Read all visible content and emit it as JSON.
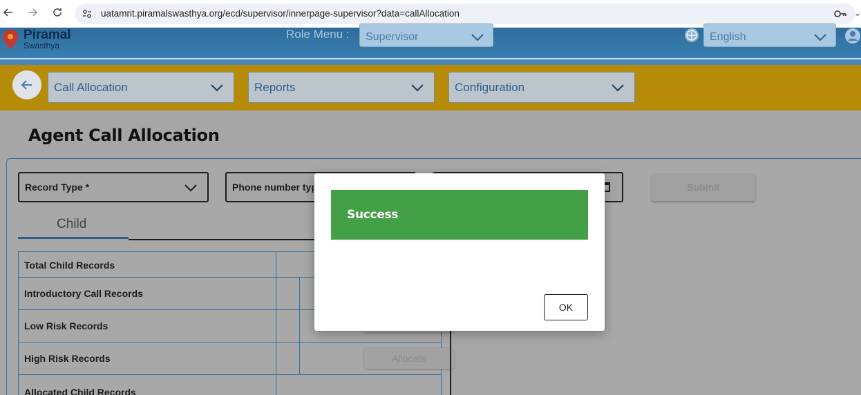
{
  "browser": {
    "url": "uatamrit.piramalswasthya.org/ecd/supervisor/innerpage-supervisor?data=callAllocation"
  },
  "header": {
    "logo_name": "Piramal",
    "logo_sub": "Swasthya",
    "role_label": "Role Menu :",
    "role_value": "Supervisor",
    "language_value": "English"
  },
  "menu": {
    "items": [
      {
        "label": "Call Allocation"
      },
      {
        "label": "Reports"
      },
      {
        "label": "Configuration"
      }
    ]
  },
  "page": {
    "title": "Agent Call Allocation",
    "filters": {
      "record_type": "Record Type *",
      "phone_number_type": "Phone number type"
    },
    "submit_label": "Submit",
    "tab_label": "Child",
    "rows": [
      {
        "label": "Total Child Records"
      },
      {
        "label": "Introductory Call Records"
      },
      {
        "label": "Low Risk Records"
      },
      {
        "label": "High Risk Records",
        "action": "Allocate"
      },
      {
        "label": "Allocated Child Records"
      }
    ]
  },
  "dialog": {
    "title": "Success",
    "ok_label": "OK"
  },
  "colors": {
    "success": "#44a047",
    "menu_bar": "#b58b08",
    "header": "#2d6c9c"
  }
}
